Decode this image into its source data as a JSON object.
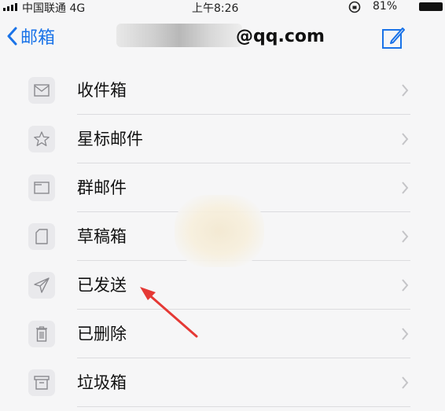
{
  "status_bar": {
    "carrier": "中国联通  4G",
    "time": "上午8:26",
    "battery": "81%"
  },
  "nav": {
    "back_label": "邮箱",
    "account": "@qq.com"
  },
  "folders": [
    {
      "label": "收件箱",
      "icon": "envelope-icon"
    },
    {
      "label": "星标邮件",
      "icon": "star-icon"
    },
    {
      "label": "群邮件",
      "icon": "folder-icon"
    },
    {
      "label": "草稿箱",
      "icon": "draft-icon"
    },
    {
      "label": "已发送",
      "icon": "sent-icon"
    },
    {
      "label": "已删除",
      "icon": "trash-icon"
    },
    {
      "label": "垃圾箱",
      "icon": "spam-icon"
    }
  ],
  "colors": {
    "accent": "#1a73e8",
    "annotation_arrow": "#e53935"
  }
}
